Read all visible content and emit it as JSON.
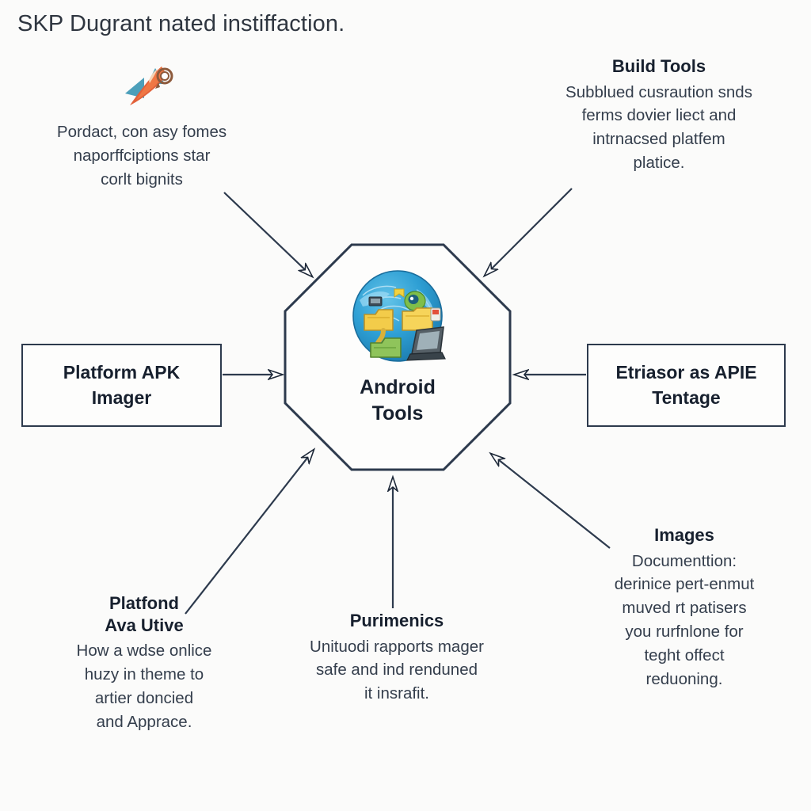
{
  "page": {
    "title": "SKP Dugrant nated instiffaction.",
    "background_color": "#fbfbfa",
    "line_color": "#2d3a4d",
    "heading_color": "#17202e",
    "body_color": "#343e4c"
  },
  "hub": {
    "label": "Android\nTools",
    "icon": "globe-folders-laptop-icon"
  },
  "nodes": {
    "left_box": {
      "label": "Platform APK\nImager"
    },
    "right_box": {
      "label": "Etriasor as APIE\nTentage"
    }
  },
  "notes": {
    "top_left": {
      "icon": "rocket-icon",
      "title": "",
      "body": "Pordact, con asy fomes\nnaporffciptions star\ncorlt bignits"
    },
    "top_right": {
      "title": "Build Tools",
      "body": "Subblued cusraution snds\nferms dovier liect and\nintrnacsed platfem\nplatice."
    },
    "bottom_left": {
      "title": "Platfond\nAva Utive",
      "body": "How a wdse onlice\nhuzy in theme to\nartier doncied\nand Apprace."
    },
    "bottom_center": {
      "title": "Purimenics",
      "body": "Unituodi rapports mager\nsafe and ind renduned\nit insrafit."
    },
    "bottom_right": {
      "title": "Images",
      "body": "Documenttion:\nderinice pert-enmut\nmuved rt patisers\nyou rurfnlone for\nteght offect\nreduoning."
    }
  },
  "connectors": [
    {
      "name": "top-left-to-hub",
      "direction": "inward"
    },
    {
      "name": "top-right-to-hub",
      "direction": "inward"
    },
    {
      "name": "left-box-to-hub",
      "direction": "inward"
    },
    {
      "name": "right-box-to-hub",
      "direction": "inward"
    },
    {
      "name": "bottom-left-to-hub",
      "direction": "inward"
    },
    {
      "name": "bottom-center-to-hub",
      "direction": "inward"
    },
    {
      "name": "bottom-right-to-hub",
      "direction": "inward"
    }
  ]
}
